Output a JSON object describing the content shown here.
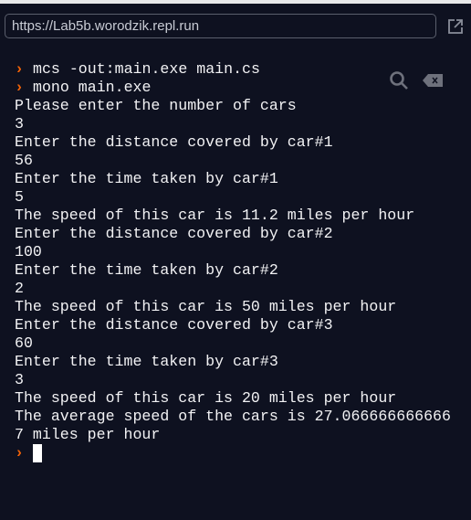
{
  "browser": {
    "url": "https://Lab5b.worodzik.repl.run",
    "icons": [
      "external-link-icon",
      "search-icon",
      "clear-console-icon"
    ]
  },
  "terminal": {
    "prompt_symbol": "›",
    "accent": "#f26207",
    "lines": [
      {
        "prompt": true,
        "text": "mcs -out:main.exe main.cs"
      },
      {
        "prompt": true,
        "text": "mono main.exe"
      },
      {
        "prompt": false,
        "text": "Please enter the number of cars"
      },
      {
        "prompt": false,
        "text": "3"
      },
      {
        "prompt": false,
        "text": "Enter the distance covered by car#1"
      },
      {
        "prompt": false,
        "text": "56"
      },
      {
        "prompt": false,
        "text": "Enter the time taken by car#1"
      },
      {
        "prompt": false,
        "text": "5"
      },
      {
        "prompt": false,
        "text": "The speed of this car is 11.2 miles per hour"
      },
      {
        "prompt": false,
        "text": "Enter the distance covered by car#2"
      },
      {
        "prompt": false,
        "text": "100"
      },
      {
        "prompt": false,
        "text": "Enter the time taken by car#2"
      },
      {
        "prompt": false,
        "text": "2"
      },
      {
        "prompt": false,
        "text": "The speed of this car is 50 miles per hour"
      },
      {
        "prompt": false,
        "text": "Enter the distance covered by car#3"
      },
      {
        "prompt": false,
        "text": "60"
      },
      {
        "prompt": false,
        "text": "Enter the time taken by car#3"
      },
      {
        "prompt": false,
        "text": "3"
      },
      {
        "prompt": false,
        "text": "The speed of this car is 20 miles per hour"
      },
      {
        "prompt": false,
        "text": "The average speed of the cars is 27.066666666666"
      },
      {
        "prompt": false,
        "text": "7 miles per hour"
      }
    ]
  }
}
